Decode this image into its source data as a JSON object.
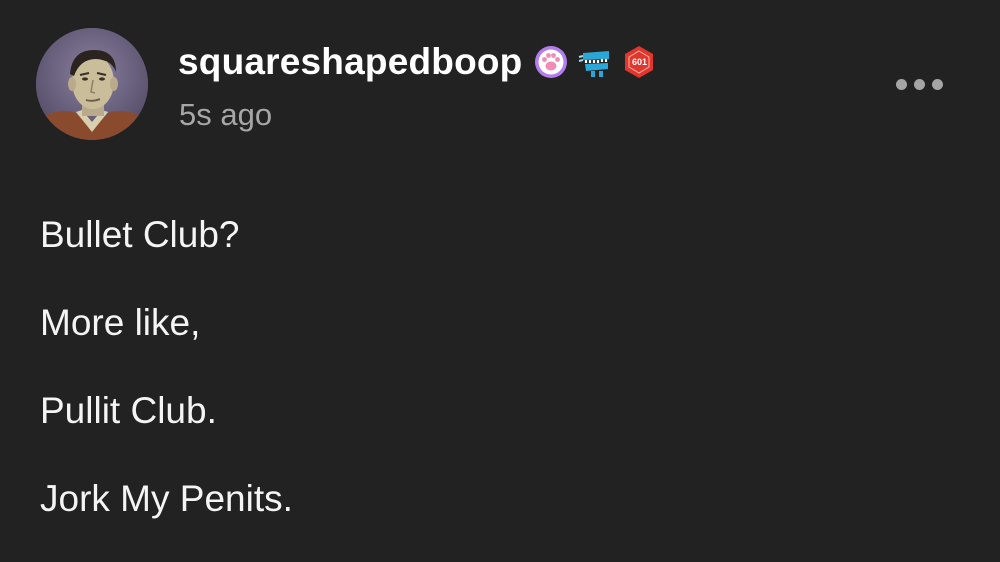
{
  "post": {
    "username": "squareshapedboop",
    "timestamp": "5s ago",
    "badges": [
      {
        "icon": "paw-badge-icon",
        "color": "#b57cf0"
      },
      {
        "icon": "wind-up-teeth-badge-icon",
        "color": "#2aa7d6"
      },
      {
        "icon": "d20-die-badge-icon",
        "color": "#e0362d"
      }
    ],
    "d20_label": "601",
    "more_icon": "more-options-icon",
    "paragraphs": [
      "Bullet Club?",
      "More like,",
      "Pullit Club.",
      "Jork My Penits."
    ]
  },
  "colors": {
    "background": "#222222",
    "text": "#f4f4f4",
    "muted": "#a7a7a7"
  }
}
